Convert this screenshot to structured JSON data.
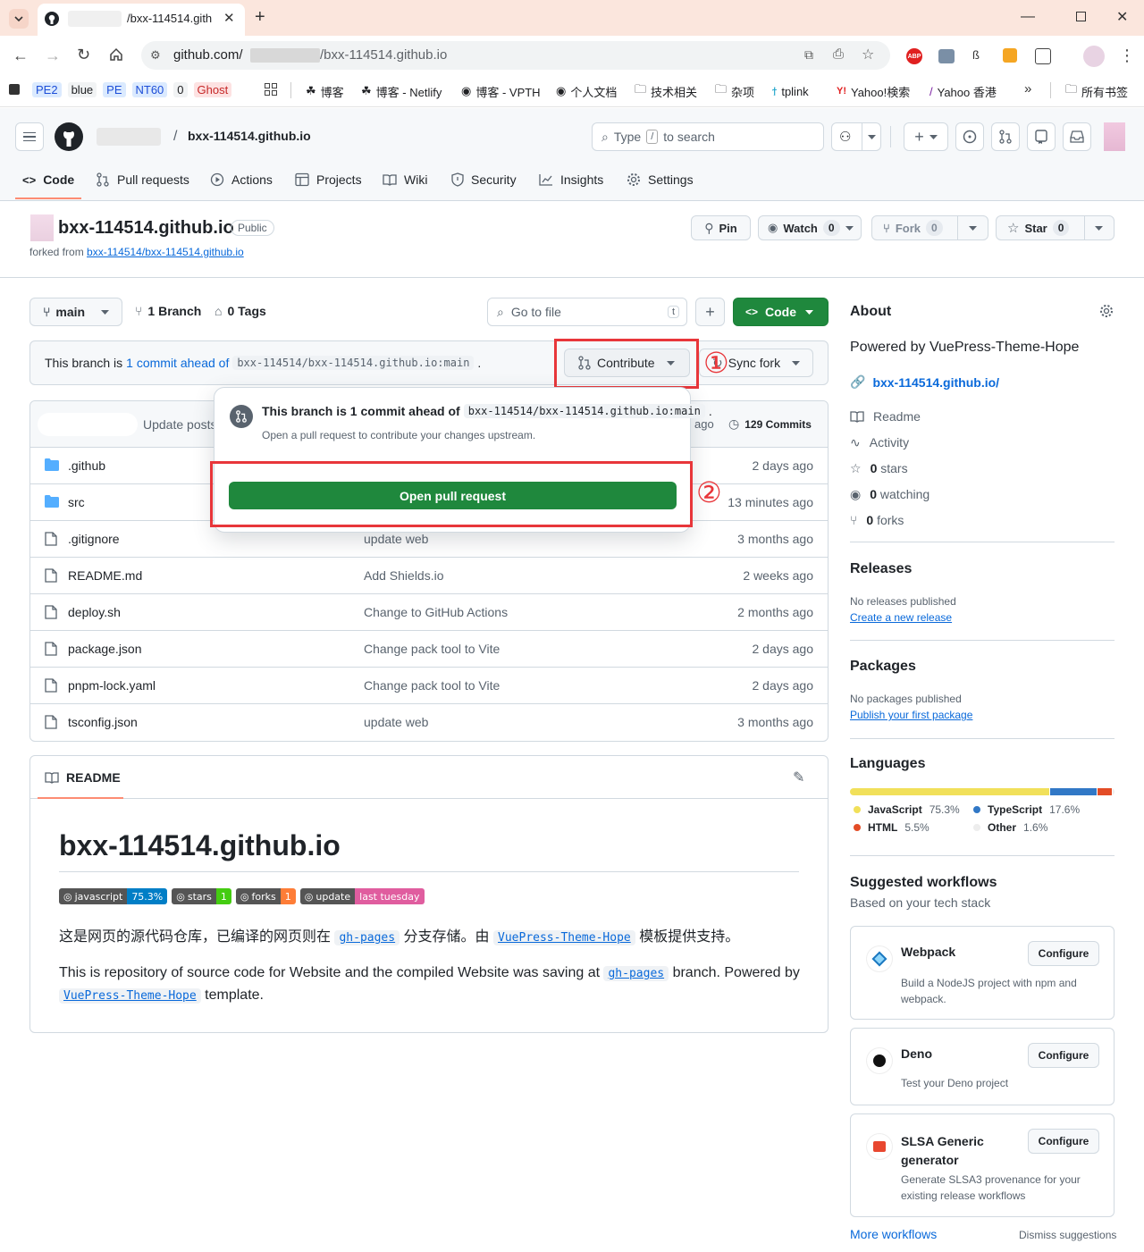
{
  "browser": {
    "tab_title": "/bxx-114514.gith",
    "url_host": "github.com/",
    "url_path": "/bxx-114514.github.io",
    "bookmarks": [
      {
        "label": "PE2",
        "bg": "#dbeafe",
        "fg": "#1d4ed8"
      },
      {
        "label": "blue",
        "bg": "#f1f3f4",
        "fg": "#202124"
      },
      {
        "label": "PE",
        "bg": "#dbeafe",
        "fg": "#1d4ed8"
      },
      {
        "label": "NT60",
        "bg": "#dbeafe",
        "fg": "#1d4ed8"
      },
      {
        "label": "0",
        "bg": "#f1f3f4",
        "fg": "#202124"
      },
      {
        "label": "Ghost",
        "bg": "#fde2e2",
        "fg": "#c62828"
      }
    ],
    "bookmarks2": [
      "博客",
      "博客 - Netlify",
      "博客 - VPTH",
      "个人文档",
      "技术相关",
      "杂项",
      "tplink",
      "Yahoo!検索",
      "Yahoo 香港"
    ],
    "all_bookmarks": "所有书签"
  },
  "header": {
    "repo_name": "bxx-114514.github.io",
    "search_placeholder_1": "Type",
    "search_key": "/",
    "search_placeholder_2": "to search"
  },
  "nav": {
    "code": "Code",
    "pulls": "Pull requests",
    "actions": "Actions",
    "projects": "Projects",
    "wiki": "Wiki",
    "security": "Security",
    "insights": "Insights",
    "settings": "Settings"
  },
  "repo": {
    "title": "bxx-114514.github.io",
    "visibility": "Public",
    "forked_from_label": "forked from",
    "forked_from_link": "bxx-114514/bxx-114514.github.io",
    "pin": "Pin",
    "watch": "Watch",
    "watch_count": "0",
    "fork": "Fork",
    "fork_count": "0",
    "star": "Star",
    "star_count": "0"
  },
  "filebar": {
    "branch": "main",
    "branches": "1 Branch",
    "tags": "0 Tags",
    "goto_placeholder": "Go to file",
    "goto_key": "t",
    "code_btn": "Code"
  },
  "ahead": {
    "prefix": "This branch is",
    "link": "1 commit ahead of",
    "ref": "bxx-114514/bxx-114514.github.io:main",
    "suffix": ".",
    "contribute": "Contribute",
    "sync": "Sync fork"
  },
  "popover": {
    "title_prefix": "This branch is 1 commit ahead of",
    "ref": "bxx-114514/bxx-114514.github.io:main",
    "dot": ".",
    "subtitle": "Open a pull request to contribute your changes upstream.",
    "button": "Open pull request"
  },
  "annotations": {
    "one": "①",
    "two": "②"
  },
  "commitbar": {
    "message": "Update posts",
    "age": "ago",
    "commits": "129 Commits"
  },
  "files": [
    {
      "name": ".github",
      "type": "dir",
      "msg": "",
      "age": "2 days ago"
    },
    {
      "name": "src",
      "type": "dir",
      "msg": "",
      "age": "13 minutes ago"
    },
    {
      "name": ".gitignore",
      "type": "file",
      "msg": "update web",
      "age": "3 months ago"
    },
    {
      "name": "README.md",
      "type": "file",
      "msg": "Add Shields.io",
      "age": "2 weeks ago"
    },
    {
      "name": "deploy.sh",
      "type": "file",
      "msg": "Change to GitHub Actions",
      "age": "2 months ago"
    },
    {
      "name": "package.json",
      "type": "file",
      "msg": "Change pack tool to Vite",
      "age": "2 days ago"
    },
    {
      "name": "pnpm-lock.yaml",
      "type": "file",
      "msg": "Change pack tool to Vite",
      "age": "2 days ago"
    },
    {
      "name": "tsconfig.json",
      "type": "file",
      "msg": "update web",
      "age": "3 months ago"
    }
  ],
  "readme": {
    "tab": "README",
    "title": "bxx-114514.github.io",
    "badges": [
      {
        "l": "javascript",
        "r": "75.3%",
        "rc": "#007ec6"
      },
      {
        "l": "stars",
        "r": "1",
        "rc": "#4c1"
      },
      {
        "l": "forks",
        "r": "1",
        "rc": "#fe7d37"
      },
      {
        "l": "update",
        "r": "last tuesday",
        "rc": "#e05d9f"
      }
    ],
    "p1_a": "这是网页的源代码仓库，已编译的网页则在",
    "p1_code": "gh-pages",
    "p1_b": "分支存储。由",
    "p1_code2": "VuePress-Theme-Hope",
    "p1_c": "模板提供支持。",
    "p2_a": "This is repository of source code for Website and the compiled Website was saving at",
    "p2_code": "gh-pages",
    "p2_b": "branch. Powered by",
    "p2_code2": "VuePress-Theme-Hope",
    "p2_c": "template."
  },
  "about": {
    "title": "About",
    "desc": "Powered by VuePress-Theme-Hope",
    "link": "bxx-114514.github.io/",
    "readme": "Readme",
    "activity": "Activity",
    "stars_n": "0",
    "stars": "stars",
    "watching_n": "0",
    "watching": "watching",
    "forks_n": "0",
    "forks": "forks"
  },
  "releases": {
    "title": "Releases",
    "none": "No releases published",
    "link": "Create a new release"
  },
  "packages": {
    "title": "Packages",
    "none": "No packages published",
    "link": "Publish your first package"
  },
  "languages": {
    "title": "Languages",
    "items": [
      {
        "name": "JavaScript",
        "pct": "75.3%",
        "value": 75.3,
        "color": "#f1e05a"
      },
      {
        "name": "TypeScript",
        "pct": "17.6%",
        "value": 17.6,
        "color": "#3178c6"
      },
      {
        "name": "HTML",
        "pct": "5.5%",
        "value": 5.5,
        "color": "#e34c26"
      },
      {
        "name": "Other",
        "pct": "1.6%",
        "value": 1.6,
        "color": "#ededed"
      }
    ]
  },
  "workflows": {
    "title": "Suggested workflows",
    "subtitle": "Based on your tech stack",
    "items": [
      {
        "name": "Webpack",
        "desc": "Build a NodeJS project with npm and webpack.",
        "btn": "Configure"
      },
      {
        "name": "Deno",
        "desc": "Test your Deno project",
        "btn": "Configure"
      },
      {
        "name": "SLSA Generic generator",
        "desc": "Generate SLSA3 provenance for your existing release workflows",
        "btn": "Configure"
      }
    ],
    "more": "More workflows",
    "dismiss": "Dismiss suggestions"
  }
}
